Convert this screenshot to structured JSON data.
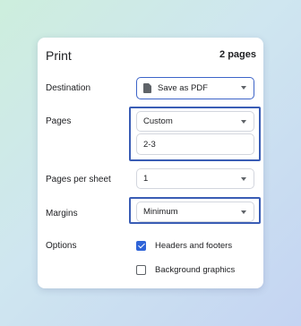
{
  "dialog": {
    "title": "Print",
    "page_count": "2 pages"
  },
  "destination": {
    "label": "Destination",
    "value": "Save as PDF",
    "icon": "document-icon"
  },
  "pages": {
    "label": "Pages",
    "value": "Custom",
    "custom_range": "2-3"
  },
  "pages_per_sheet": {
    "label": "Pages per sheet",
    "value": "1"
  },
  "margins": {
    "label": "Margins",
    "value": "Minimum"
  },
  "options": {
    "label": "Options",
    "items": [
      {
        "label": "Headers and footers",
        "checked": true
      },
      {
        "label": "Background graphics",
        "checked": false
      }
    ]
  },
  "colors": {
    "accent": "#3a5db5",
    "checkbox": "#2f64d8"
  }
}
